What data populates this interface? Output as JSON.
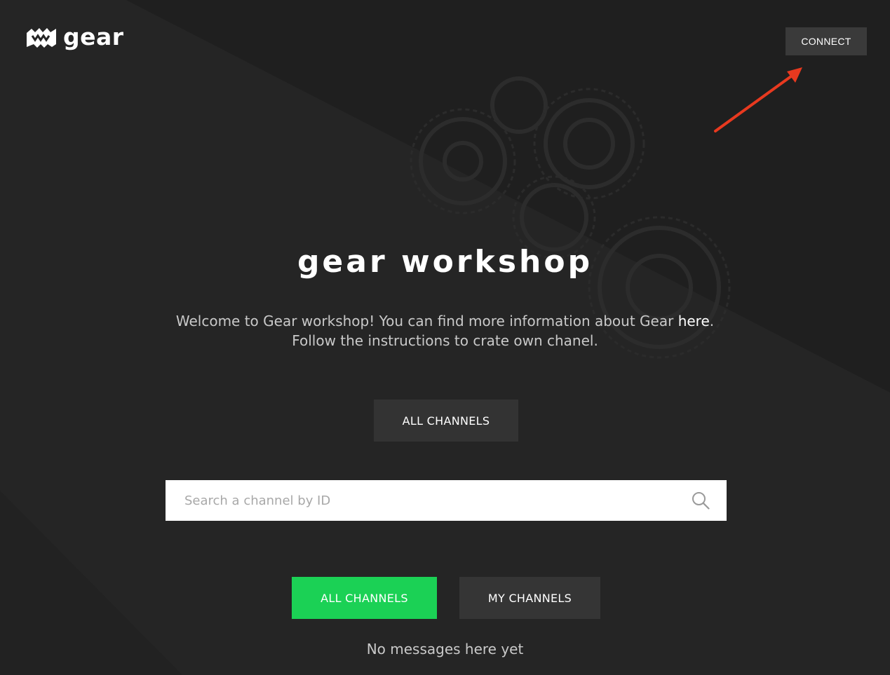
{
  "header": {
    "logo_text": "gear",
    "connect_label": "CONNECT"
  },
  "hero": {
    "title": "Gear workshop",
    "welcome_line1_before": "Welcome to Gear workshop! You can find more information about Gear ",
    "welcome_link": "here",
    "welcome_line1_after": ".",
    "welcome_line2": "Follow the instructions to crate own chanel.",
    "all_channels_label": "ALL CHANNELS"
  },
  "search": {
    "placeholder": "Search a channel by ID"
  },
  "tabs": {
    "all_label": "ALL CHANNELS",
    "my_label": "MY CHANNELS",
    "active": "all"
  },
  "list": {
    "empty_message": "No messages here yet"
  },
  "colors": {
    "background": "#252525",
    "accent_green": "#1bd155",
    "annotation_arrow": "#e8391f"
  }
}
